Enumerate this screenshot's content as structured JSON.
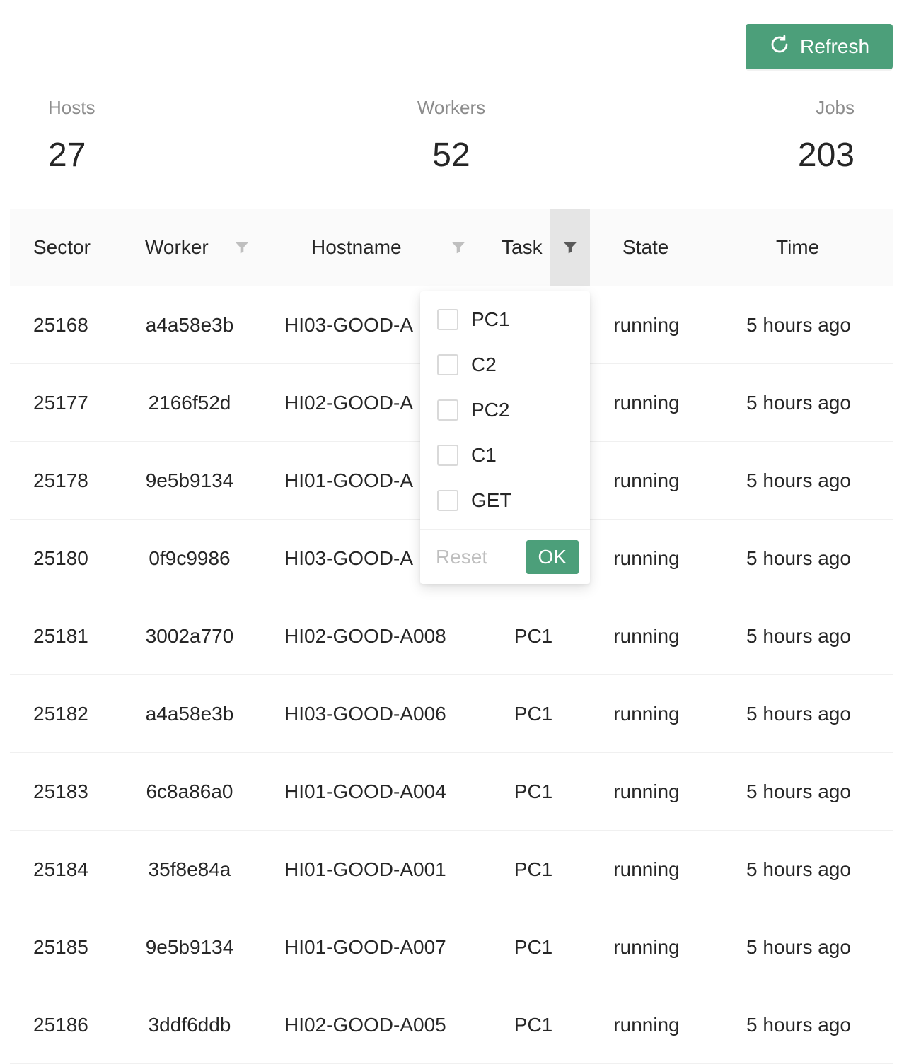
{
  "toolbar": {
    "refresh_label": "Refresh"
  },
  "stats": [
    {
      "label": "Hosts",
      "value": "27"
    },
    {
      "label": "Workers",
      "value": "52"
    },
    {
      "label": "Jobs",
      "value": "203"
    }
  ],
  "table": {
    "columns": [
      "Sector",
      "Worker",
      "Hostname",
      "Task",
      "State",
      "Time"
    ],
    "rows": [
      {
        "sector": "25168",
        "worker": "a4a58e3b",
        "hostname": "HI03-GOOD-A",
        "task": "",
        "state": "running",
        "time": "5 hours ago"
      },
      {
        "sector": "25177",
        "worker": "2166f52d",
        "hostname": "HI02-GOOD-A",
        "task": "",
        "state": "running",
        "time": "5 hours ago"
      },
      {
        "sector": "25178",
        "worker": "9e5b9134",
        "hostname": "HI01-GOOD-A",
        "task": "",
        "state": "running",
        "time": "5 hours ago"
      },
      {
        "sector": "25180",
        "worker": "0f9c9986",
        "hostname": "HI03-GOOD-A",
        "task": "",
        "state": "running",
        "time": "5 hours ago"
      },
      {
        "sector": "25181",
        "worker": "3002a770",
        "hostname": "HI02-GOOD-A008",
        "task": "PC1",
        "state": "running",
        "time": "5 hours ago"
      },
      {
        "sector": "25182",
        "worker": "a4a58e3b",
        "hostname": "HI03-GOOD-A006",
        "task": "PC1",
        "state": "running",
        "time": "5 hours ago"
      },
      {
        "sector": "25183",
        "worker": "6c8a86a0",
        "hostname": "HI01-GOOD-A004",
        "task": "PC1",
        "state": "running",
        "time": "5 hours ago"
      },
      {
        "sector": "25184",
        "worker": "35f8e84a",
        "hostname": "HI01-GOOD-A001",
        "task": "PC1",
        "state": "running",
        "time": "5 hours ago"
      },
      {
        "sector": "25185",
        "worker": "9e5b9134",
        "hostname": "HI01-GOOD-A007",
        "task": "PC1",
        "state": "running",
        "time": "5 hours ago"
      },
      {
        "sector": "25186",
        "worker": "3ddf6ddb",
        "hostname": "HI02-GOOD-A005",
        "task": "PC1",
        "state": "running",
        "time": "5 hours ago"
      }
    ]
  },
  "task_filter": {
    "options": [
      "PC1",
      "C2",
      "PC2",
      "C1",
      "GET"
    ],
    "reset_label": "Reset",
    "ok_label": "OK"
  },
  "colors": {
    "accent": "#4c9f7a",
    "muted": "#8c8c8c",
    "border": "#f0f0f0"
  }
}
